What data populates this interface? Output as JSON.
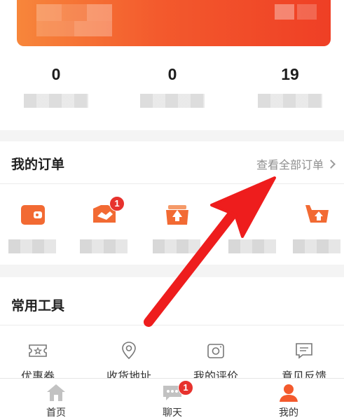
{
  "stats": [
    {
      "value": "0"
    },
    {
      "value": "0"
    },
    {
      "value": "19"
    }
  ],
  "orders": {
    "title": "我的订单",
    "view_all": "查看全部订单",
    "items": [
      {
        "icon": "wallet-icon"
      },
      {
        "icon": "handshake-icon",
        "badge": "1"
      },
      {
        "icon": "box-upload-icon"
      },
      {
        "icon": "hidden-icon"
      },
      {
        "icon": "cart-upload-icon"
      }
    ]
  },
  "tools": {
    "title": "常用工具",
    "items": [
      {
        "label": "优惠券",
        "icon": "coupon-icon"
      },
      {
        "label": "收货地址",
        "icon": "location-pin-icon"
      },
      {
        "label": "我的评价",
        "icon": "camera-icon"
      },
      {
        "label": "意见反馈",
        "icon": "feedback-icon"
      }
    ]
  },
  "tabbar": {
    "items": [
      {
        "label": "首页",
        "icon": "home-icon"
      },
      {
        "label": "聊天",
        "icon": "chat-icon",
        "badge": "1"
      },
      {
        "label": "我的",
        "icon": "profile-icon"
      }
    ]
  },
  "colors": {
    "accent": "#f35a2d",
    "badge": "#e7322d",
    "arrow": "#ee1d1d",
    "inactive_tab": "#b9b9b9"
  }
}
